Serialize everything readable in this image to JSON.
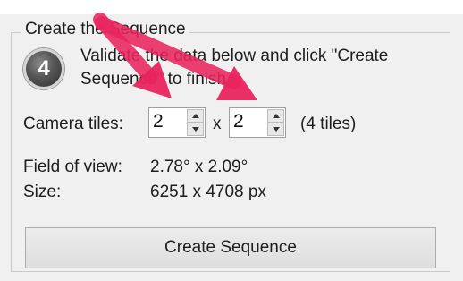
{
  "section": {
    "title": "Create the Sequence",
    "step_number": "4",
    "instructions": "Validate the data below and click \"Create Sequence\" to finish."
  },
  "camera_tiles": {
    "label": "Camera tiles:",
    "x_value": "2",
    "separator": "x",
    "y_value": "2",
    "total": "(4 tiles)"
  },
  "field_of_view": {
    "label": "Field of view:",
    "value": "2.78° x 2.09°"
  },
  "size": {
    "label": "Size:",
    "value": "6251 x 4708 px"
  },
  "actions": {
    "create_label": "Create Sequence"
  },
  "colors": {
    "annotation_arrow": "#e8245e"
  }
}
